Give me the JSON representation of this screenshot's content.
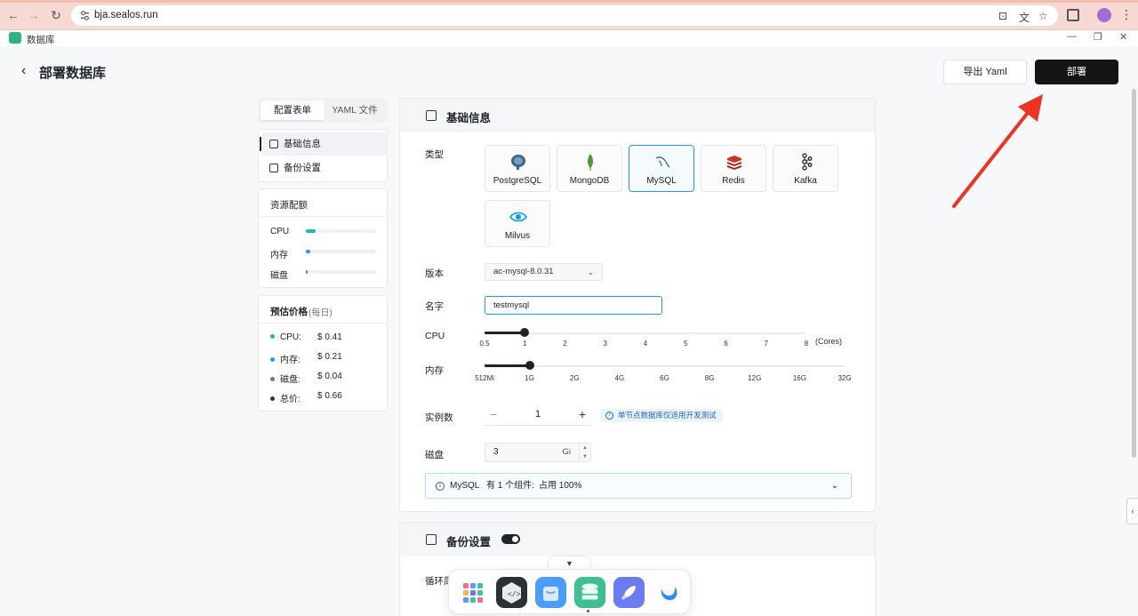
{
  "browser": {
    "url": "bja.sealos.run"
  },
  "app": {
    "title": "数据库"
  },
  "header": {
    "title": "部署数据库",
    "export_label": "导出 Yaml",
    "deploy_label": "部署"
  },
  "left_tabs": [
    {
      "label": "配置表单"
    },
    {
      "label": "YAML 文件"
    }
  ],
  "left_nav": [
    {
      "label": "基础信息"
    },
    {
      "label": "备份设置"
    }
  ],
  "resources": {
    "title": "资源配额",
    "items": [
      {
        "label": "CPU",
        "fill": 0.14,
        "color": "#25b3b7"
      },
      {
        "label": "内存",
        "fill": 0.06,
        "color": "#219bf4"
      },
      {
        "label": "磁盘",
        "fill": 0.02,
        "color": "#7e60d3"
      }
    ]
  },
  "price": {
    "title": "预估价格",
    "subtitle": "(每日)",
    "items": [
      {
        "label": "CPU:",
        "value": "$ 0.41",
        "color": "#25b3b7"
      },
      {
        "label": "内存:",
        "value": "$ 0.21",
        "color": "#219bf4"
      },
      {
        "label": "磁盘:",
        "value": "$ 0.04",
        "color": "#7e60d3"
      },
      {
        "label": "总价:",
        "value": "$ 0.66",
        "color": "#333333"
      }
    ]
  },
  "basic": {
    "title": "基础信息",
    "type_label": "类型",
    "db_types": [
      {
        "label": "PostgreSQL",
        "icon": "postgresql-icon"
      },
      {
        "label": "MongoDB",
        "icon": "mongodb-icon"
      },
      {
        "label": "MySQL",
        "icon": "mysql-icon",
        "selected": true
      },
      {
        "label": "Redis",
        "icon": "redis-icon"
      },
      {
        "label": "Kafka",
        "icon": "kafka-icon"
      },
      {
        "label": "Milvus",
        "icon": "milvus-icon"
      }
    ],
    "version_label": "版本",
    "version_value": "ac-mysql-8.0.31",
    "name_label": "名字",
    "name_value": "testmysql",
    "cpu_label": "CPU",
    "cpu_ticks": [
      "0.5",
      "1",
      "2",
      "3",
      "4",
      "5",
      "6",
      "7",
      "8"
    ],
    "cpu_value": "1",
    "cpu_unit": "(Cores)",
    "mem_label": "内存",
    "mem_ticks": [
      "512Mi",
      "1G",
      "2G",
      "4G",
      "6G",
      "8G",
      "12G",
      "16G",
      "32G"
    ],
    "mem_value": "1G",
    "replicas_label": "实例数",
    "replicas_value": "1",
    "replicas_hint": "单节点数据库仅适用开发测试",
    "disk_label": "磁盘",
    "disk_value": "3",
    "disk_unit": "Gi",
    "summary_name": "MySQL",
    "summary_text": "有 1 个组件:",
    "summary_usage": "占用 100%"
  },
  "backup": {
    "title": "备份设置",
    "enabled": true,
    "cycle_label": "循环周"
  }
}
